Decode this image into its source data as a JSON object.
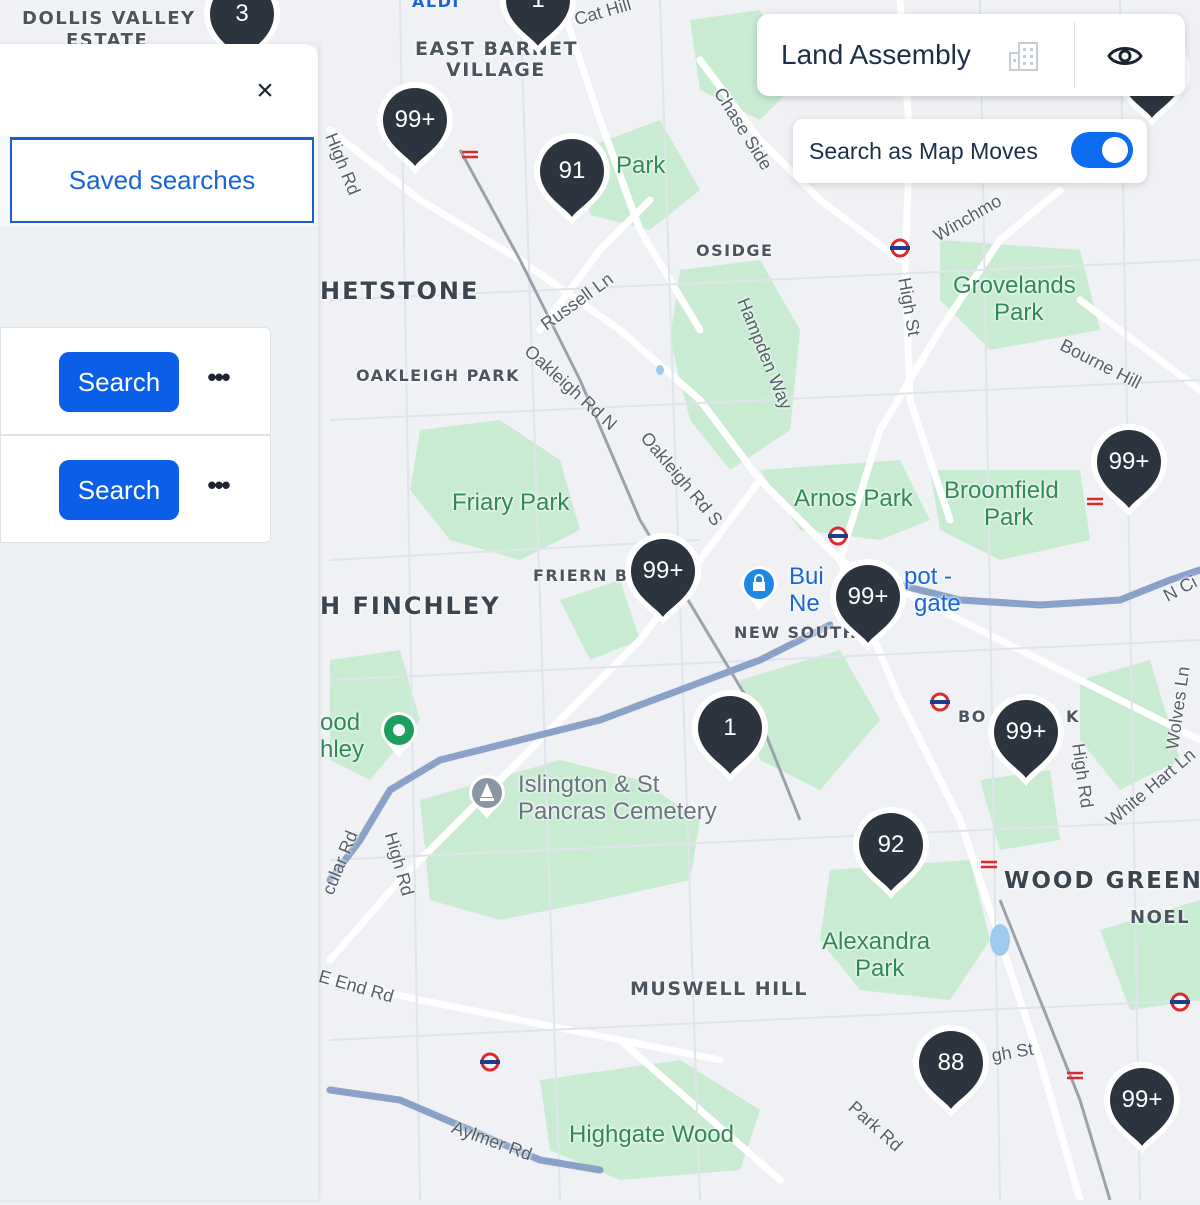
{
  "panel": {
    "close_glyph": "×",
    "saved_tab_label": "Saved searches",
    "cards": [
      {
        "search_label": "Search",
        "more_label": "•••"
      },
      {
        "search_label": "Search",
        "more_label": "•••"
      }
    ]
  },
  "controls": {
    "land_title": "Land Assembly",
    "search_as_map_moves": "Search as Map Moves",
    "search_as_map_moves_on": true,
    "building_icon": "building-icon",
    "eye_icon": "eye-icon"
  },
  "colors": {
    "marker": "#2c3440",
    "primary_button": "#0b5ee8",
    "toggle_on": "#0b6cf0",
    "park_text": "#2f8a55"
  },
  "map": {
    "places": {
      "dollis_valley_1": "DOLLIS VALLEY",
      "dollis_valley_2": "ESTATE",
      "east_barnet_1": "EAST BARNET",
      "east_barnet_2": "VILLAGE",
      "whetstone": "HETSTONE",
      "oakleigh_park": "OAKLEIGH PARK",
      "osidge": "OSIDGE",
      "friern": "FRIERN B",
      "north_finchley": "H FINCHLEY",
      "new_south": "NEW SOUTH",
      "wood_green": "WOOD GREEN",
      "noel": "NOEL",
      "muswell_hill": "MUSWELL HILL",
      "bo": "BO",
      "k": "K",
      "aldi": "ALDI"
    },
    "parks": {
      "park_top": "Park",
      "grovelands_1": "Grovelands",
      "grovelands_2": "Park",
      "friary": "Friary Park",
      "arnos": "Arnos Park",
      "broomfield_1": "Broomfield",
      "broomfield_2": "Park",
      "alexandra_1": "Alexandra",
      "alexandra_2": "Park",
      "highgate_wood": "Highgate Wood",
      "wood_1": "ood",
      "wood_2": "hley"
    },
    "pois": {
      "islington_1": "Islington & St",
      "islington_2": "Pancras Cemetery",
      "bui": "Bui",
      "ne": "Ne",
      "pot": "pot -",
      "gate": "gate"
    },
    "roads": {
      "cat_hill": "Cat Hill",
      "chase_side": "Chase Side",
      "high_rd_top": "High Rd",
      "winchmore": "Winchmo",
      "high_st_mid": "High St",
      "russell_ln": "Russell Ln",
      "hampden_way": "Hampden Way",
      "bourne_hill": "Bourne Hill",
      "oakleigh_rd_n": "Oakleigh Rd N",
      "oakleigh_rd_s": "Oakleigh Rd S",
      "nci": "N Ci",
      "wolves_ln": "Wolves Ln",
      "high_rd_right": "High Rd",
      "white_hart_ln": "White Hart Ln",
      "cular_rd": "cular Rd",
      "high_rd_left": "High Rd",
      "e_end_rd": "E End Rd",
      "gh_st": "gh St",
      "park_rd": "Park Rd",
      "aylmer_rd": "Aylmer Rd"
    },
    "markers": [
      {
        "label": "3"
      },
      {
        "label": "1"
      },
      {
        "label": "99+"
      },
      {
        "label": "91"
      },
      {
        "label": "99+"
      },
      {
        "label": "99+"
      },
      {
        "label": "99+"
      },
      {
        "label": "1"
      },
      {
        "label": "99+"
      },
      {
        "label": "92"
      },
      {
        "label": "88"
      },
      {
        "label": "99+"
      },
      {
        "label": ""
      }
    ]
  }
}
